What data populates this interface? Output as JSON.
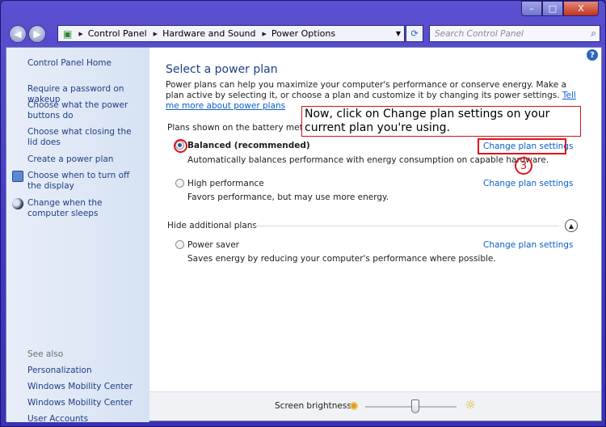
{
  "window": {
    "controls": {
      "minimize": "–",
      "maximize": "□",
      "close": "X"
    }
  },
  "nav": {
    "back": "◀",
    "forward": "▶"
  },
  "address": {
    "crumbs": [
      "Control Panel",
      "Hardware and Sound",
      "Power Options"
    ]
  },
  "search": {
    "placeholder": "Search Control Panel"
  },
  "sidebar": {
    "home": "Control Panel Home",
    "items": [
      {
        "label": "Require a password on wakeup"
      },
      {
        "label": "Choose what the power buttons do"
      },
      {
        "label": "Choose what closing the lid does"
      },
      {
        "label": "Create a power plan"
      },
      {
        "label": "Choose when to turn off the display",
        "icon": "display-clock-icon"
      },
      {
        "label": "Change when the computer sleeps",
        "icon": "moon-icon"
      }
    ],
    "see_also": "See also",
    "see_also_items": [
      "Personalization",
      "Windows Mobility Center",
      "User Accounts"
    ]
  },
  "main": {
    "title": "Select a power plan",
    "description": "Power plans can help you maximize your computer's performance or conserve energy. Make a plan active by selecting it, or choose a plan and customize it by changing its power settings.",
    "more_link": "Tell me more about power plans",
    "battery_section": "Plans shown on the battery meter",
    "hide_section": "Hide additional plans",
    "change_label": "Change plan settings",
    "plans": [
      {
        "name": "Balanced (recommended)",
        "desc": "Automatically balances performance with energy consumption on capable hardware.",
        "selected": true
      },
      {
        "name": "High performance",
        "desc": "Favors performance, but may use more energy.",
        "selected": false
      },
      {
        "name": "Power saver",
        "desc": "Saves energy by reducing your computer's performance where possible.",
        "selected": false
      }
    ]
  },
  "annotation": {
    "text": "Now, click on Change plan settings on your current plan you're using.",
    "step": "3",
    "color": "#e0141a"
  },
  "bottom": {
    "brightness_label": "Screen brightness:",
    "brightness_percent": 55
  }
}
